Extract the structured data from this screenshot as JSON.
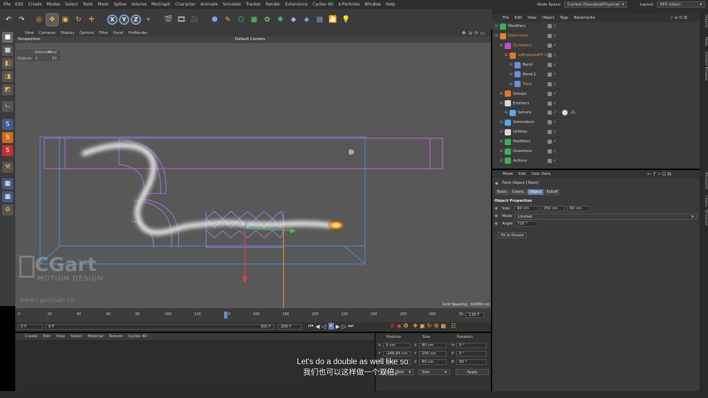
{
  "menu": [
    "File",
    "Edit",
    "Create",
    "Modes",
    "Select",
    "Tools",
    "Mesh",
    "Spline",
    "Volume",
    "MoGraph",
    "Character",
    "Animate",
    "Simulate",
    "Tracker",
    "Render",
    "Extensions",
    "Cycles 4D",
    "X-Particles",
    "Window",
    "Help"
  ],
  "nodespace": {
    "label": "Node Space:",
    "value": "Current (Standard/Physical)",
    "layout_label": "Layout:",
    "layout_value": "EFX (User)"
  },
  "toolbar": {
    "axes": [
      "X",
      "Y",
      "Z"
    ]
  },
  "viewport": {
    "menu": [
      "View",
      "Cameras",
      "Display",
      "Options",
      "Filter",
      "Panel",
      "ProRender"
    ],
    "view_name": "Perspective",
    "camera": "Default Camera",
    "grid_spacing": "Grid Spacing : 10000 cm",
    "stats": {
      "header_selected": "Selected",
      "header_total": "Total",
      "row_label": "Objects",
      "selected": "1",
      "total": "33"
    }
  },
  "watermark": {
    "brand": "CGart",
    "sub": "MOTION DESIGN",
    "url": "www.cgartisan.cn"
  },
  "timeline": {
    "ticks": [
      "0",
      "20",
      "40",
      "60",
      "80",
      "100",
      "120",
      "140",
      "160",
      "180",
      "200",
      "220",
      "240",
      "260",
      "280",
      "30"
    ],
    "current": "139 F"
  },
  "transport": {
    "start": "0 F",
    "start2": "0 F",
    "end": "300 F",
    "end2": "300 F"
  },
  "material": {
    "menu": [
      "Create",
      "Edit",
      "View",
      "Select",
      "Material",
      "Texture",
      "Cycles 4D"
    ]
  },
  "coords": {
    "headers": [
      "Position",
      "Size",
      "Rotation"
    ],
    "rows": [
      {
        "a": "X",
        "av": "0 cm",
        "b": "X",
        "bv": "80 cm",
        "c": "H",
        "cv": "0 °"
      },
      {
        "a": "Y",
        "av": "-248.65 cm",
        "b": "Y",
        "bv": "250 cm",
        "c": "P",
        "cv": "0 °"
      },
      {
        "a": "Z",
        "av": "0 cm",
        "b": "Z",
        "bv": "80 cm",
        "c": "B",
        "cv": "90 °"
      }
    ],
    "mode1": "Object (Rel)",
    "mode2": "Size",
    "apply": "Apply"
  },
  "subtitle": {
    "en": "Let's do a double as well like so",
    "zh": "我们也可以这样做一个双倍。"
  },
  "objects": {
    "menu": [
      "File",
      "Edit",
      "View",
      "Object",
      "Tags",
      "Bookmarks"
    ],
    "items": [
      {
        "name": "Modifiers",
        "indent": 0,
        "color": "#3fae5e",
        "nameColor": "#d9d9d9"
      },
      {
        "name": "Deformers",
        "indent": 0,
        "color": "#e0823c",
        "nameColor": "#e8934a"
      },
      {
        "name": "Dynamics",
        "indent": 1,
        "color": "#c04dd8",
        "nameColor": "#e8934a"
      },
      {
        "name": "xpExplosiaFX 1",
        "indent": 2,
        "color": "#e07832",
        "nameColor": "#e8934a"
      },
      {
        "name": "Bend",
        "indent": 3,
        "color": "#6b8fd8",
        "nameColor": "#d9d9d9"
      },
      {
        "name": "Bend.1",
        "indent": 3,
        "color": "#6b8fd8",
        "nameColor": "#d9d9d9"
      },
      {
        "name": "Twist",
        "indent": 3,
        "color": "#6b8fd8",
        "nameColor": "#e8934a"
      },
      {
        "name": "Groups",
        "indent": 1,
        "color": "#e07832",
        "nameColor": "#d9d9d9"
      },
      {
        "name": "Emitters",
        "indent": 1,
        "color": "#d8d8d8",
        "nameColor": "#d9d9d9"
      },
      {
        "name": "Sphere",
        "indent": 2,
        "color": "#5aa8e8",
        "nameColor": "#d9d9d9"
      },
      {
        "name": "Generators",
        "indent": 1,
        "color": "#5aa8e8",
        "nameColor": "#d9d9d9"
      },
      {
        "name": "Utilities",
        "indent": 1,
        "color": "#d8d8d8",
        "nameColor": "#d9d9d9"
      },
      {
        "name": "Modifiers",
        "indent": 1,
        "color": "#3fae5e",
        "nameColor": "#d9d9d9"
      },
      {
        "name": "Questions",
        "indent": 1,
        "color": "#3fae5e",
        "nameColor": "#d9d9d9"
      },
      {
        "name": "Actions",
        "indent": 1,
        "color": "#3fae5e",
        "nameColor": "#d9d9d9"
      }
    ]
  },
  "attributes": {
    "menu": [
      "Mode",
      "Edit",
      "User Data"
    ],
    "title": "Twist Object [Twist]",
    "tabs": [
      "Basic",
      "Coord.",
      "Object",
      "Falloff"
    ],
    "section": "Object Properties",
    "size_label": "Size",
    "size": [
      "80 cm",
      "250 cm",
      "80 cm"
    ],
    "mode_label": "Mode",
    "mode": "Limited",
    "angle_label": "Angle",
    "angle": "720 °",
    "fit": "Fit to Parent"
  },
  "sidetabs": [
    "Objects",
    "Takes",
    "Content Browser",
    "Attributes",
    "Layers",
    "Structure"
  ],
  "colors": {
    "accent": "#6482b4",
    "check": "#3ee07a"
  }
}
